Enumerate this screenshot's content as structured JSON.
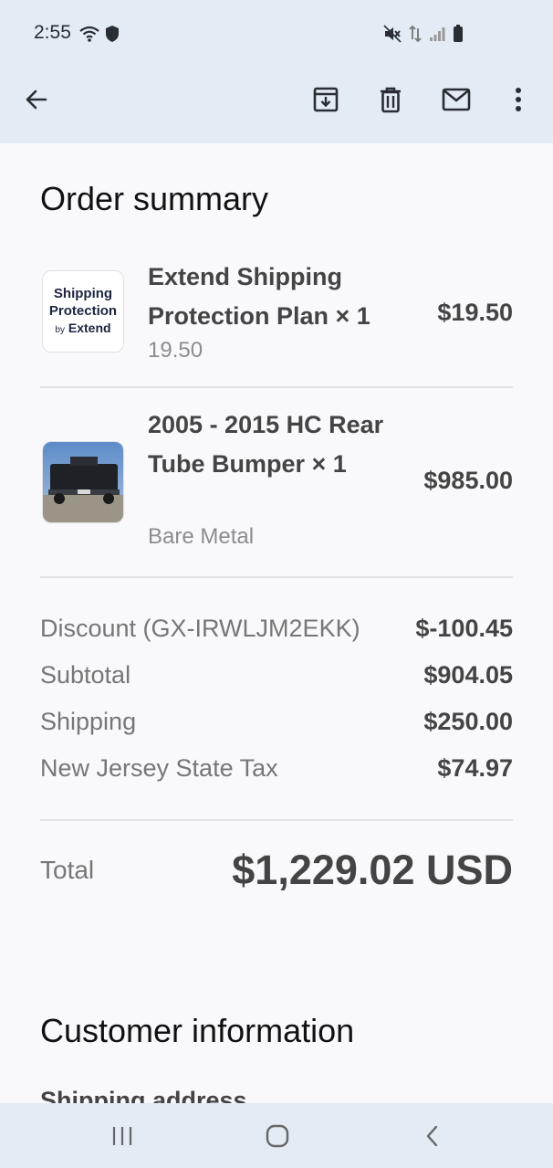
{
  "status_bar": {
    "time": "2:55",
    "left_icons": [
      "wifi-icon",
      "shield-icon"
    ],
    "right_icons": [
      "mute-icon",
      "data-icon",
      "signal-icon",
      "battery-icon"
    ]
  },
  "app_bar": {
    "icons": [
      "back-arrow-icon",
      "archive-icon",
      "delete-icon",
      "mail-icon",
      "more-vert-icon"
    ]
  },
  "order_summary": {
    "title": "Order summary",
    "items": [
      {
        "thumb_lines": [
          "Shipping",
          "Protection",
          "by",
          "Extend"
        ],
        "name": "Extend Shipping Protection Plan × 1",
        "sub": "19.50",
        "price": "$19.50"
      },
      {
        "thumb_alt": "truck rear bumper photo",
        "name": "2005 - 2015 HC Rear Tube Bumper × 1",
        "sub": "Bare Metal",
        "price": "$985.00"
      }
    ],
    "lines": [
      {
        "label": "Discount (GX-IRWLJM2EKK)",
        "value": "$-100.45"
      },
      {
        "label": "Subtotal",
        "value": "$904.05"
      },
      {
        "label": "Shipping",
        "value": "$250.00"
      },
      {
        "label": "New Jersey State Tax",
        "value": "$74.97"
      }
    ],
    "total_label": "Total",
    "total_value": "$1,229.02 USD"
  },
  "customer_info": {
    "title": "Customer information",
    "shipping_address_label": "Shipping address"
  },
  "nav_bar": {
    "icons": [
      "recents-icon",
      "home-icon",
      "back-icon"
    ]
  }
}
